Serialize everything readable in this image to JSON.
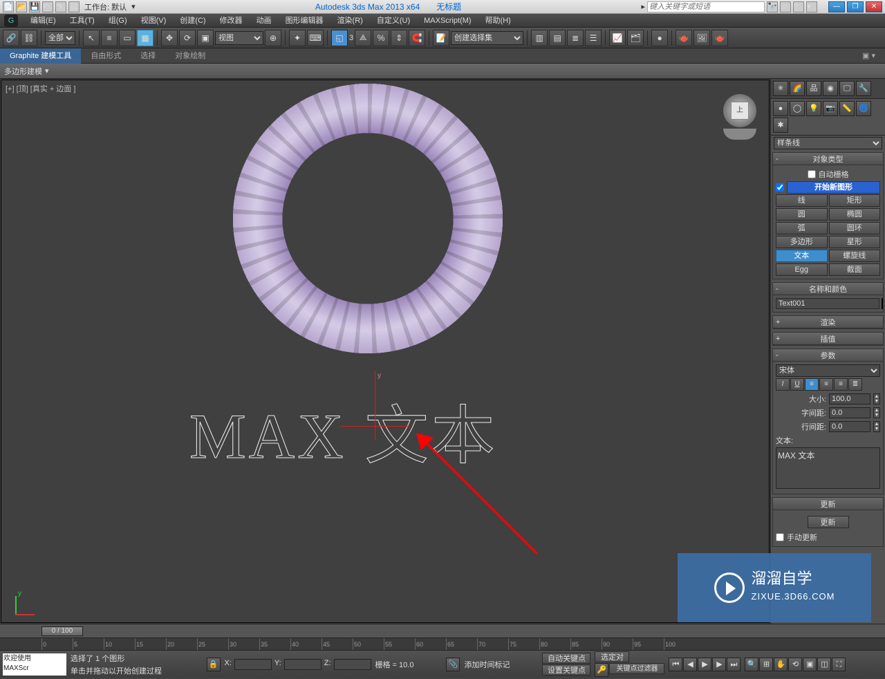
{
  "titlebar": {
    "app_title": "Autodesk 3ds Max  2013 x64",
    "doc_title": "无标题",
    "workspace_label": "工作台: 默认",
    "search_placeholder": "键入关键字或短语",
    "btn_minimize": "—",
    "btn_restore": "❐",
    "btn_close": "✕"
  },
  "menus": [
    "编辑(E)",
    "工具(T)",
    "组(G)",
    "视图(V)",
    "创建(C)",
    "修改器",
    "动画",
    "图形编辑器",
    "渲染(R)",
    "自定义(U)",
    "MAXScript(M)",
    "帮助(H)"
  ],
  "toolbar": {
    "filter_all": "全部",
    "view_dropdown": "视图",
    "named_selset": "创建选择集",
    "angle_label": "3"
  },
  "ribbon": {
    "tabs": [
      "Graphite 建模工具",
      "自由形式",
      "选择",
      "对象绘制"
    ],
    "sub": "多边形建模"
  },
  "viewport": {
    "label": "[+] [顶] [真实 + 边面 ]",
    "cube_face": "上",
    "text_object": "MAX 文本",
    "axis_y": "y"
  },
  "panel": {
    "category": "样条线",
    "section_objtype": "对象类型",
    "auto_grid": "自动栅格",
    "start_new": "开始新图形",
    "types": [
      "线",
      "矩形",
      "圆",
      "椭圆",
      "弧",
      "圆环",
      "多边形",
      "星形",
      "文本",
      "螺旋线",
      "Egg",
      "截面"
    ],
    "section_namecolor": "名称和颜色",
    "obj_name": "Text001",
    "section_render": "渲染",
    "section_interp": "插值",
    "section_params": "参数",
    "font": "宋体",
    "size_label": "大小:",
    "size_val": "100.0",
    "kerning_label": "字间距:",
    "kerning_val": "0.0",
    "leading_label": "行间距:",
    "leading_val": "0.0",
    "text_label": "文本:",
    "text_content": "MAX 文本",
    "section_update": "更新",
    "update_btn": "更新",
    "manual_update": "手动更新"
  },
  "timeline": {
    "knob": "0 / 100",
    "ticks": [
      0,
      5,
      10,
      15,
      20,
      25,
      30,
      35,
      40,
      45,
      50,
      55,
      60,
      65,
      70,
      75,
      80,
      85,
      90,
      95,
      100
    ]
  },
  "status": {
    "welcome_line1": "欢迎使用",
    "welcome_line2": "MAXScr",
    "msg_top": "选择了 1 个图形",
    "msg_bottom": "单击并拖动以开始创建过程",
    "x": "X:",
    "y": "Y:",
    "z": "Z:",
    "grid": "栅格 = 10.0",
    "addtime": "添加时间标记",
    "autokey": "自动关键点",
    "setkey": "设置关键点",
    "selfilter": "选定对",
    "keyfilter": "关键点过滤器"
  },
  "watermark": {
    "title": "溜溜自学",
    "sub": "ZIXUE.3D66.COM"
  }
}
